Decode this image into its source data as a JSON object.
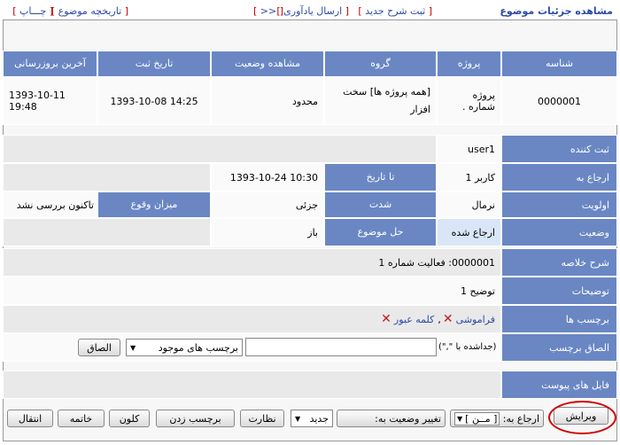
{
  "topbar": {
    "title": "مشاهده جزئیات موضوع",
    "new_desc": "ثبت شرح جدید",
    "send_reminder": "ارسال یادآوری",
    "nav": "<<",
    "history": "تاریخچه موضوع",
    "print": "چـــاپ"
  },
  "table": {
    "headers": [
      "شناسه",
      "پروژه",
      "گروه",
      "مشاهده وضعیت",
      "تاریخ ثبت",
      "آخرین بروزرسانی"
    ],
    "row": [
      "0000001",
      "پروژه شماره .",
      "[همه پروژه ها] سخت افزار",
      "محدود",
      "1393-10-08 14:25",
      "1393-10-11 19:48"
    ]
  },
  "details": {
    "reporter_label": "ثبت کننده",
    "reporter_value": "user1",
    "assigned_label": "ارجاع به",
    "assigned_value": "کاربر 1",
    "until_label": "تا تاریخ",
    "until_value": "1393-10-24 10:30",
    "priority_label": "اولویت",
    "priority_value": "نرمال",
    "severity_label": "شدت",
    "severity_value": "جزئی",
    "reproducibility_label": "میزان وقوع",
    "reproducibility_value": "تاکنون بررسی نشد",
    "status_label": "وضعیت",
    "status_value": "ارجاع شده",
    "resolution_label": "حل موضوع",
    "resolution_value": "باز",
    "summary_label": "شرح خلاصه",
    "summary_value": "0000001: فعالیت شماره 1",
    "description_label": "توضیحات",
    "description_value": "توضیح 1",
    "tags_label": "برچسب ها",
    "tag1": "فراموشی",
    "tag2": "کلمه عبور",
    "attach_tag_label": "الصاق برچسب",
    "tag_hint": "(جداشده با \",\")",
    "existing_tags": "برچسب های موجود",
    "attach_button": "الصاق",
    "files_label": "فایل های پیوست"
  },
  "actions": {
    "edit": "ویرایش",
    "assign_to": "ارجاع به:",
    "assign_select": "[ مــن ]",
    "change_status": "تغییر وضعیت به:",
    "status_select": "جدید",
    "monitor": "نظارت",
    "tag": "برچسب زدن",
    "clone": "کلون",
    "close": "خاتمه",
    "move": "انتقال"
  },
  "colors": {
    "header_bg": "#6a87c4",
    "cell_bg": "#e9e9e9",
    "highlight": "#d00000"
  }
}
